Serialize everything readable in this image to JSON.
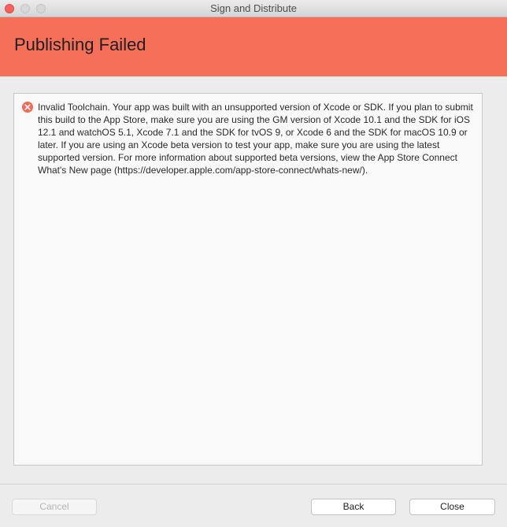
{
  "window": {
    "title": "Sign and Distribute"
  },
  "banner": {
    "title": "Publishing Failed",
    "color": "#f66f59"
  },
  "message": {
    "icon": "error-icon",
    "text": "Invalid Toolchain. Your app was built with an unsupported version of Xcode or SDK. If you plan to submit this build to the App Store, make sure you are using the GM version of Xcode 10.1 and the SDK for iOS 12.1 and watchOS 5.1, Xcode 7.1 and the SDK for tvOS 9, or Xcode 6 and the SDK for macOS 10.9 or later. If you are using an Xcode beta version to test your app, make sure you are using the latest supported version. For more information about supported beta versions, view the App Store Connect What's New page (https://developer.apple.com/app-store-connect/whats-new/)."
  },
  "footer": {
    "cancel_label": "Cancel",
    "back_label": "Back",
    "close_label": "Close"
  }
}
